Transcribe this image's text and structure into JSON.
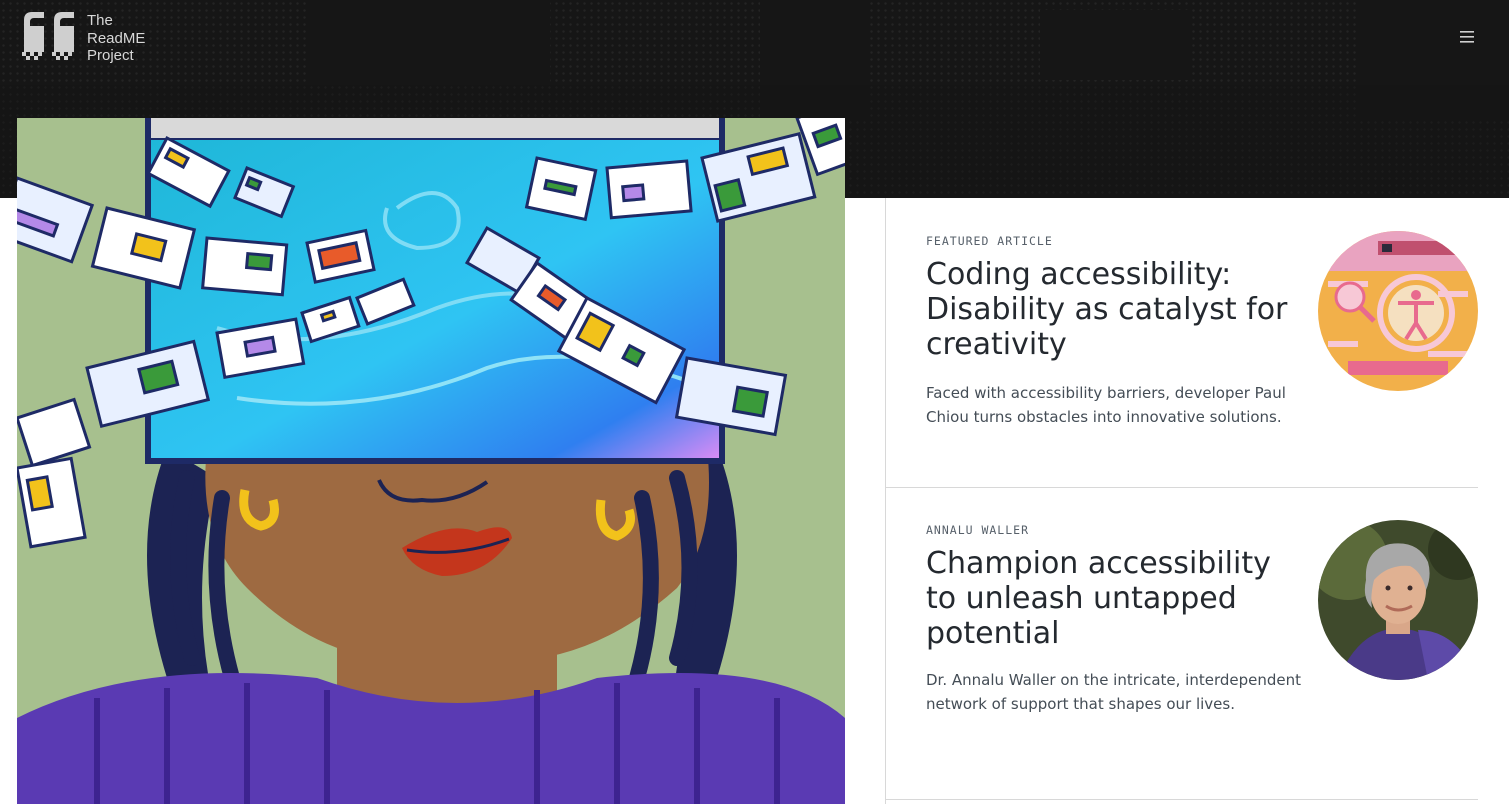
{
  "header": {
    "logo_lines": [
      "The",
      "ReadME",
      "Project"
    ],
    "menu_icon": "hamburger-menu-icon"
  },
  "hero": {
    "image": "illustration-woman-with-screen-over-eyes"
  },
  "articles": [
    {
      "eyebrow": "FEATURED ARTICLE",
      "title": "Coding accessibility: Disability as catalyst for creativity",
      "description": "Faced with accessibility barriers, developer Paul Chiou turns obstacles into innovative solutions.",
      "thumbnail": "accessibility-illustration-circle"
    },
    {
      "eyebrow": "ANNALU WALLER",
      "title": "Champion accessibility to unleash untapped potential",
      "description": "Dr. Annalu Waller on the intricate, interdependent network of support that shapes our lives.",
      "thumbnail": "annalu-waller-portrait"
    }
  ],
  "colors": {
    "header_bg": "#161616",
    "logo_text": "#d8d8d8",
    "title_text": "#24292f",
    "eyebrow_text": "#57606a",
    "divider": "#d8d8d8"
  }
}
